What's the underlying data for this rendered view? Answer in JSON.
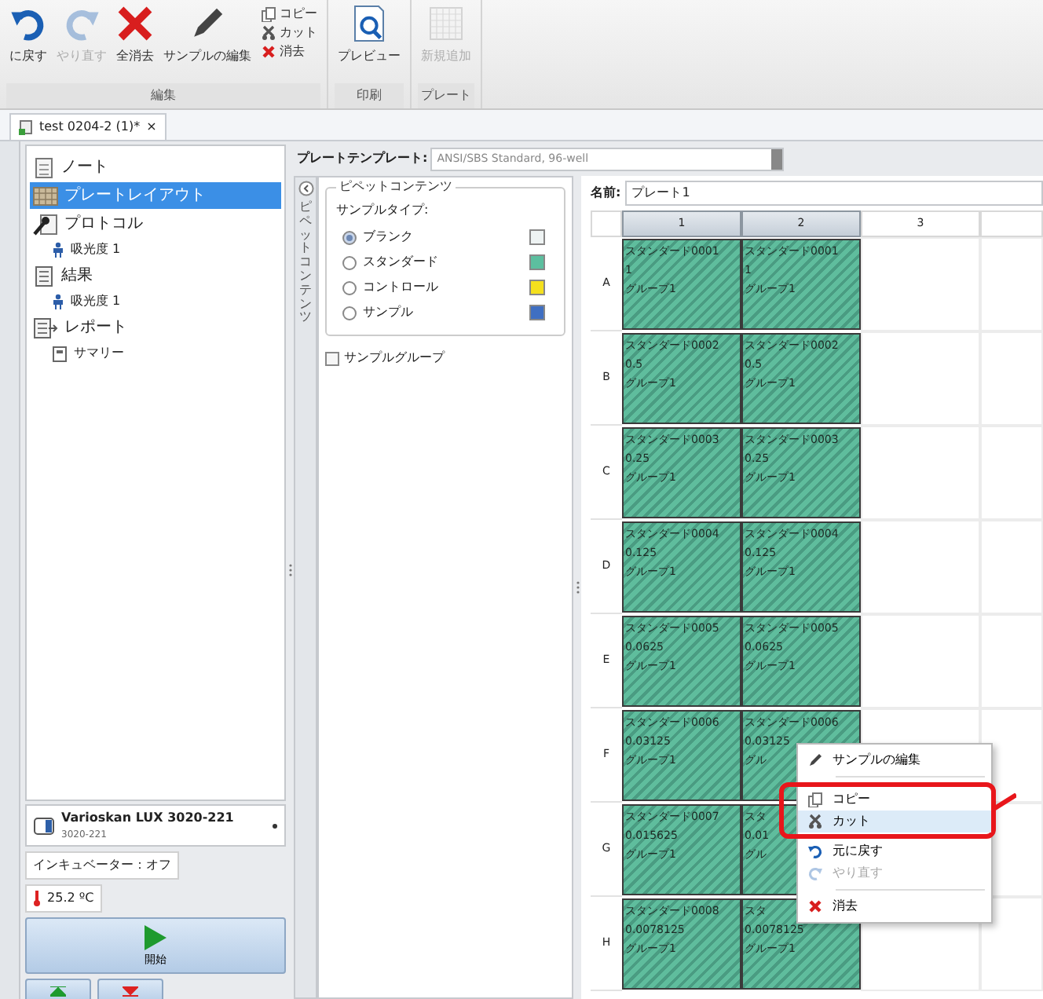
{
  "toolbar": {
    "groups": [
      {
        "label": "編集",
        "items": [
          {
            "kind": "undo",
            "label": "に戻す",
            "disabled": false
          },
          {
            "kind": "redo",
            "label": "やり直す",
            "disabled": true
          },
          {
            "kind": "clear",
            "label": "全消去",
            "disabled": false
          },
          {
            "kind": "edit",
            "label": "サンプルの編集",
            "disabled": false
          }
        ],
        "small_items": [
          {
            "kind": "copy",
            "label": "コピー",
            "disabled": false
          },
          {
            "kind": "cut",
            "label": "カット",
            "disabled": false
          },
          {
            "kind": "delete",
            "label": "消去",
            "disabled": false
          }
        ]
      },
      {
        "label": "印刷",
        "items": [
          {
            "kind": "preview",
            "label": "プレビュー",
            "disabled": false
          }
        ]
      },
      {
        "label": "プレート",
        "items": [
          {
            "kind": "add",
            "label": "新規追加",
            "disabled": true
          }
        ]
      }
    ]
  },
  "document_tab": {
    "label": "test 0204-2 (1)*",
    "close": "×"
  },
  "tree": [
    {
      "kind": "note",
      "label": "ノート",
      "selected": false
    },
    {
      "kind": "layout",
      "label": "プレートレイアウト",
      "selected": true
    },
    {
      "kind": "protocol",
      "label": "プロトコル",
      "selected": false,
      "children": [
        {
          "kind": "measure",
          "label": "吸光度 1",
          "selected": false
        }
      ]
    },
    {
      "kind": "result",
      "label": "結果",
      "selected": false,
      "children": [
        {
          "kind": "measure",
          "label": "吸光度 1",
          "selected": false
        }
      ]
    },
    {
      "kind": "report",
      "label": "レポート",
      "selected": false,
      "children": [
        {
          "kind": "summary",
          "label": "サマリー",
          "selected": false
        }
      ]
    }
  ],
  "instrument": {
    "name": "Varioskan LUX 3020-221",
    "serial": "3020-221",
    "incubator": "インキュベーター：オフ",
    "temperature": "25.2 ºC",
    "start": "開始"
  },
  "plate_template": {
    "label": "プレートテンプレート:",
    "value": "ANSI/SBS Standard, 96-well"
  },
  "pipette": {
    "side_label": "ピペットコンテンツ",
    "title": "ピペットコンテンツ",
    "type_label": "サンプルタイプ:",
    "types": [
      {
        "label": "ブランク",
        "selected": true,
        "color": "#eef3f3"
      },
      {
        "label": "スタンダード",
        "selected": false,
        "color": "#5cbf9f"
      },
      {
        "label": "コントロール",
        "selected": false,
        "color": "#f4e01e"
      },
      {
        "label": "サンプル",
        "selected": false,
        "color": "#3f6fc2"
      }
    ],
    "group_checkbox": {
      "label": "サンプルグループ",
      "checked": false
    }
  },
  "plate": {
    "name_label": "名前:",
    "name": "プレート1",
    "columns": [
      {
        "label": "1",
        "selected": true
      },
      {
        "label": "2",
        "selected": true
      },
      {
        "label": "3",
        "selected": false
      }
    ],
    "rows": [
      {
        "label": "A",
        "wells": [
          {
            "kind": "standard",
            "lines": [
              "スタンダード0001",
              "1",
              "グループ1"
            ]
          },
          {
            "kind": "standard",
            "lines": [
              "スタンダード0001",
              "1",
              "グループ1"
            ]
          }
        ]
      },
      {
        "label": "B",
        "wells": [
          {
            "kind": "standard",
            "lines": [
              "スタンダード0002",
              "0.5",
              "グループ1"
            ]
          },
          {
            "kind": "standard",
            "lines": [
              "スタンダード0002",
              "0.5",
              "グループ1"
            ]
          }
        ]
      },
      {
        "label": "C",
        "wells": [
          {
            "kind": "standard",
            "lines": [
              "スタンダード0003",
              "0.25",
              "グループ1"
            ]
          },
          {
            "kind": "standard",
            "lines": [
              "スタンダード0003",
              "0.25",
              "グループ1"
            ]
          }
        ]
      },
      {
        "label": "D",
        "wells": [
          {
            "kind": "standard",
            "lines": [
              "スタンダード0004",
              "0.125",
              "グループ1"
            ]
          },
          {
            "kind": "standard",
            "lines": [
              "スタンダード0004",
              "0.125",
              "グループ1"
            ]
          }
        ]
      },
      {
        "label": "E",
        "wells": [
          {
            "kind": "standard",
            "lines": [
              "スタンダード0005",
              "0.0625",
              "グループ1"
            ]
          },
          {
            "kind": "standard",
            "lines": [
              "スタンダード0005",
              "0.0625",
              "グループ1"
            ]
          }
        ]
      },
      {
        "label": "F",
        "wells": [
          {
            "kind": "standard",
            "lines": [
              "スタンダード0006",
              "0.03125",
              "グループ1"
            ]
          },
          {
            "kind": "standard",
            "lines": [
              "スタンダード0006",
              "0.03125",
              "グル"
            ]
          }
        ]
      },
      {
        "label": "G",
        "wells": [
          {
            "kind": "standard",
            "lines": [
              "スタンダード0007",
              "0.015625",
              "グループ1"
            ]
          },
          {
            "kind": "standard",
            "lines": [
              "スタ",
              "0.01",
              "グル"
            ]
          }
        ]
      },
      {
        "label": "H",
        "wells": [
          {
            "kind": "standard",
            "lines": [
              "スタンダード0008",
              "0.0078125",
              "グループ1"
            ]
          },
          {
            "kind": "standard",
            "lines": [
              "スタ",
              "0.0078125",
              "グループ1"
            ]
          }
        ]
      }
    ]
  },
  "context_menu": [
    {
      "kind": "edit",
      "label": "サンプルの編集",
      "selected": false,
      "disabled": false
    },
    {
      "kind": "separator"
    },
    {
      "kind": "copy",
      "label": "コピー",
      "selected": false,
      "disabled": false,
      "highlighted": true
    },
    {
      "kind": "cut",
      "label": "カット",
      "selected": true,
      "disabled": false,
      "highlighted": true
    },
    {
      "kind": "undo",
      "label": "元に戻す",
      "selected": false,
      "disabled": false
    },
    {
      "kind": "redo",
      "label": "やり直す",
      "selected": false,
      "disabled": true
    },
    {
      "kind": "separator"
    },
    {
      "kind": "delete",
      "label": "消去",
      "selected": false,
      "disabled": false
    }
  ]
}
